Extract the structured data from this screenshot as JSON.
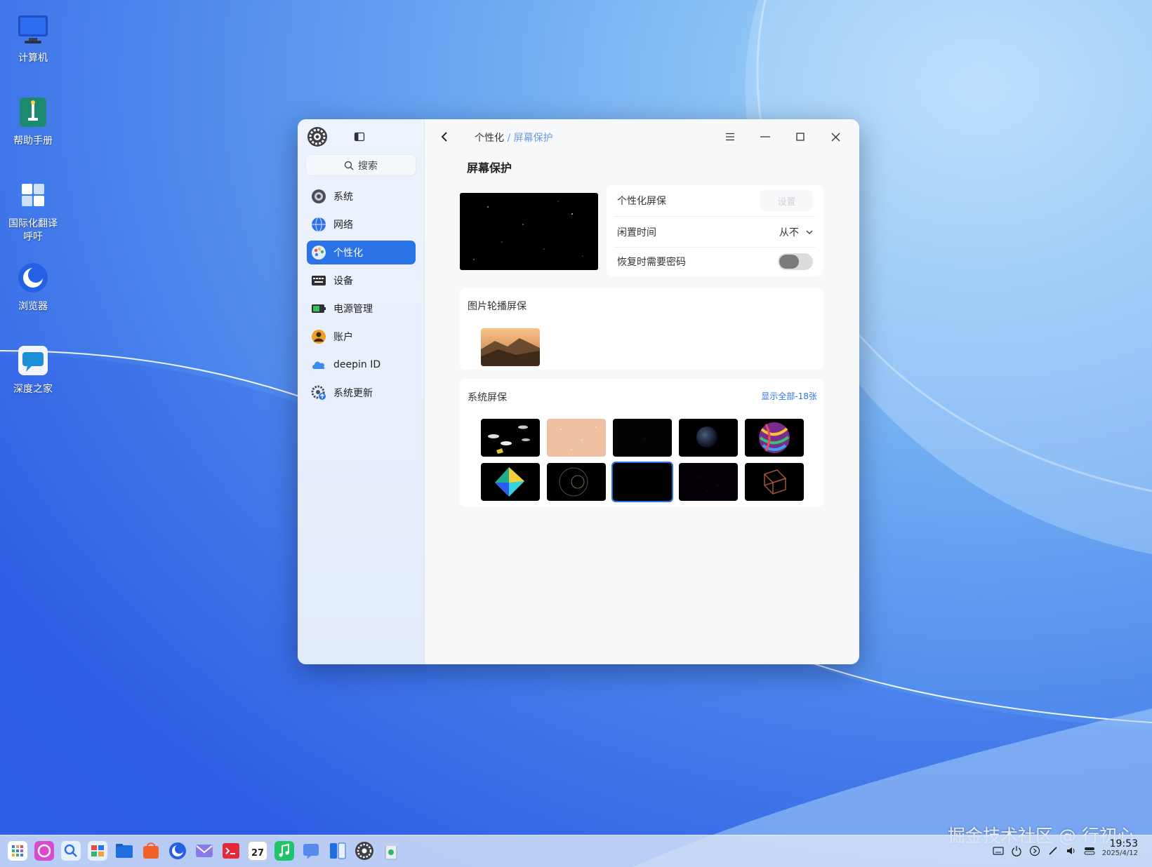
{
  "desktop": {
    "icons": [
      {
        "label": "计算机"
      },
      {
        "label": "帮助手册"
      },
      {
        "label": "国际化翻译\n呼吁"
      },
      {
        "label": "浏览器"
      },
      {
        "label": "深度之家"
      }
    ]
  },
  "window": {
    "sidebar": {
      "search_placeholder": "搜索",
      "items": [
        {
          "label": "系统",
          "icon": "system-icon"
        },
        {
          "label": "网络",
          "icon": "network-icon"
        },
        {
          "label": "个性化",
          "icon": "personalization-icon",
          "active": true
        },
        {
          "label": "设备",
          "icon": "device-icon"
        },
        {
          "label": "电源管理",
          "icon": "power-icon"
        },
        {
          "label": "账户",
          "icon": "account-icon"
        },
        {
          "label": "deepin ID",
          "icon": "cloud-icon"
        },
        {
          "label": "系统更新",
          "icon": "update-icon"
        }
      ]
    },
    "breadcrumb": {
      "parent": "个性化",
      "separator": "/",
      "current": "屏幕保护"
    },
    "page_title": "屏幕保护",
    "settings": {
      "custom_label": "个性化屏保",
      "custom_button": "设置",
      "idle_label": "闲置时间",
      "idle_value": "从不",
      "password_label": "恢复时需要密码",
      "password_on": false
    },
    "slideshow": {
      "title": "图片轮播屏保"
    },
    "system": {
      "title": "系统屏保",
      "show_all": "显示全部-18张",
      "selected_index": 7
    }
  },
  "taskbar": {
    "time": "19:53",
    "date": "2025/4/12",
    "calendar_day": "27"
  },
  "watermark": "掘金技术社区 @ 行初心",
  "colors": {
    "accent": "#2a73e6"
  }
}
